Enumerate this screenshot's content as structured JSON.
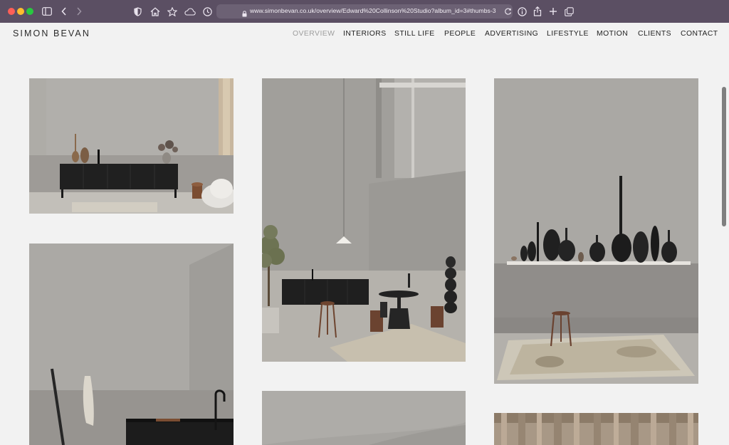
{
  "browser": {
    "url": "www.simonbevan.co.uk/overview/Edward%20Collinson%20Studio?album_id=3#thumbs-3",
    "buttons": [
      "sidebar-icon",
      "back-icon",
      "forward-icon",
      "privacy-shield-icon",
      "home-icon",
      "bookmark-star-icon",
      "icloud-icon",
      "history-clock-icon",
      "reload-icon",
      "info-icon",
      "share-icon",
      "new-tab-icon",
      "tabs-overview-icon"
    ]
  },
  "site": {
    "logo": "SIMON BEVAN",
    "nav": [
      {
        "label": "OVERVIEW",
        "active": true
      },
      {
        "label": "INTERIORS",
        "active": false
      },
      {
        "label": "STILL LIFE",
        "active": false
      },
      {
        "label": "PEOPLE",
        "active": false
      },
      {
        "label": "ADVERTISING",
        "active": false
      },
      {
        "label": "LIFESTYLE",
        "active": false
      },
      {
        "label": "MOTION",
        "active": false
      },
      {
        "label": "CLIENTS",
        "active": false
      },
      {
        "label": "CONTACT",
        "active": false
      }
    ]
  },
  "gallery": {
    "thumbnails": [
      "kitchen-sideboard-photo",
      "studio-table-stools-photo",
      "wooden-paddles-shelf-photo",
      "sink-counter-photo",
      "curved-wall-photo",
      "linen-curtain-photo"
    ]
  },
  "colors": {
    "chrome": "#5b4f63",
    "page_bg": "#f2f2f2",
    "nav_active": "#9d9d9d",
    "nav_text": "#1f1f1f"
  }
}
